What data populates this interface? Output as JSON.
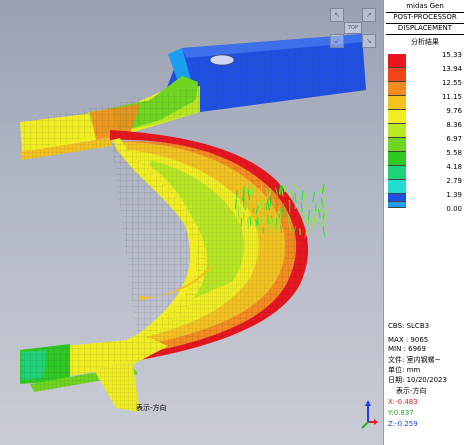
{
  "app": {
    "name": "midas Gen",
    "module": "POST-PROCESSOR",
    "result_type": "DISPLACEMENT"
  },
  "legend": {
    "title": "分析結果",
    "entries": [
      {
        "value": "15.33",
        "color": "#e8141e"
      },
      {
        "value": "13.94",
        "color": "#f0441a"
      },
      {
        "value": "12.55",
        "color": "#f58a1e"
      },
      {
        "value": "11.15",
        "color": "#f4c21e"
      },
      {
        "value": "9.76",
        "color": "#f0ee22"
      },
      {
        "value": "8.36",
        "color": "#b8e822"
      },
      {
        "value": "6.97",
        "color": "#6fd51e"
      },
      {
        "value": "5.58",
        "color": "#2ec822"
      },
      {
        "value": "4.18",
        "color": "#1ed27a"
      },
      {
        "value": "2.79",
        "color": "#22dcd2"
      },
      {
        "value": "1.39",
        "color": "#1e9ef0"
      },
      {
        "value": "0.00",
        "color": "#1e50e6"
      }
    ]
  },
  "info": {
    "cbs": "CBS: SLCB3",
    "max": "MAX : 9065",
    "min": "MIN : 6969",
    "file": "文件: 室内钢螺~",
    "unit": "单位: mm",
    "date": "日期: 10/20/2023",
    "view_direction": "表示-方向",
    "x_dir": "X:-0.483",
    "y_dir": "Y:0.837",
    "z_dir": "Z:-0.259"
  },
  "viewcube": {
    "center_label": "TOP"
  },
  "axis": {
    "x_color": "#e02020",
    "y_color": "#20b020",
    "z_color": "#2040e0",
    "caption": "表示-方向"
  }
}
